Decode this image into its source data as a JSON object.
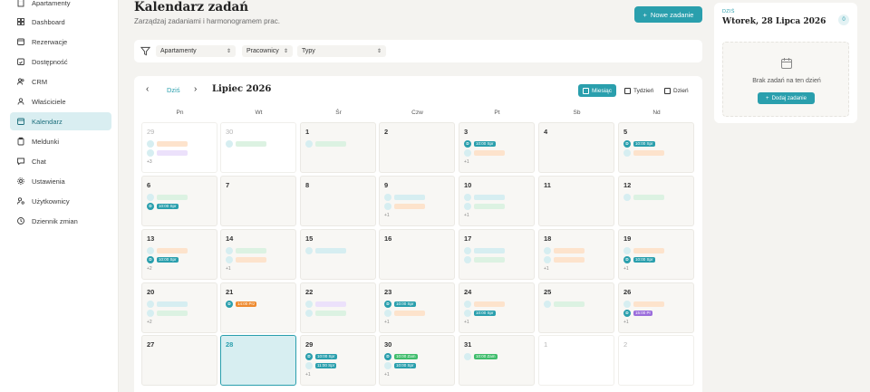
{
  "sidebar": {
    "items": [
      {
        "label": "Apartamenty",
        "icon": "building-icon",
        "active": false
      },
      {
        "label": "Dashboard",
        "icon": "grid-icon",
        "active": false
      },
      {
        "label": "Rezerwacje",
        "icon": "calendar-icon",
        "active": false
      },
      {
        "label": "Dostępność",
        "icon": "calendar-check-icon",
        "active": false
      },
      {
        "label": "CRM",
        "icon": "users-icon",
        "active": false
      },
      {
        "label": "Właściciele",
        "icon": "user-icon",
        "active": false
      },
      {
        "label": "Kalendarz",
        "icon": "calendar-icon",
        "active": true
      },
      {
        "label": "Meldunki",
        "icon": "clipboard-icon",
        "active": false
      },
      {
        "label": "Chat",
        "icon": "chat-icon",
        "active": false
      },
      {
        "label": "Ustawienia",
        "icon": "gear-icon",
        "active": false
      },
      {
        "label": "Użytkownicy",
        "icon": "user-cog-icon",
        "active": false
      },
      {
        "label": "Dziennik zmian",
        "icon": "history-icon",
        "active": false
      }
    ]
  },
  "header": {
    "title": "Kalendarz zadań",
    "subtitle": "Zarządzaj zadaniami i harmonogramem prac.",
    "new_task_label": "Nowe zadanie"
  },
  "filters": {
    "apartments": "Apartamenty",
    "workers": "Pracownicy",
    "types": "Typy"
  },
  "calendar": {
    "today_label": "Dziś",
    "month_label": "Lipiec 2026",
    "views": [
      {
        "label": "Miesiąc",
        "active": true
      },
      {
        "label": "Tydzień",
        "active": false
      },
      {
        "label": "Dzień",
        "active": false
      }
    ],
    "weekdays": [
      "Pn",
      "Wt",
      "Śr",
      "Czw",
      "Pt",
      "Sb",
      "Nd"
    ],
    "colors": {
      "teal": "#2a9fad",
      "green": "#3fbd6b",
      "orange": "#ee8a2e",
      "purple": "#9b6ddb",
      "light_green": "#dcf2e2",
      "light_orange": "#fde3cc",
      "light_purple": "#ece1fb",
      "light_teal": "#d6eef1"
    },
    "weeks": [
      [
        {
          "day": "29",
          "outside": true,
          "events": [
            {
              "dot": "",
              "color": "light_teal",
              "pill": "",
              "pill_color": "light_orange"
            },
            {
              "dot": "",
              "color": "light_teal",
              "pill": "",
              "pill_color": "light_purple"
            }
          ],
          "more": "+3"
        },
        {
          "day": "30",
          "outside": true,
          "events": [
            {
              "dot": "",
              "color": "light_teal",
              "pill": "",
              "pill_color": "light_green"
            }
          ],
          "more": ""
        },
        {
          "day": "1",
          "events": [
            {
              "dot": "",
              "color": "light_teal",
              "pill": "",
              "pill_color": "light_green"
            }
          ],
          "more": ""
        },
        {
          "day": "2",
          "events": [],
          "more": ""
        },
        {
          "day": "3",
          "events": [
            {
              "dot": "D",
              "color": "teal",
              "pill": "10:00 Spr",
              "pill_color": "teal"
            },
            {
              "dot": "",
              "color": "light_teal",
              "pill": "",
              "pill_color": "light_orange"
            }
          ],
          "more": "+1"
        },
        {
          "day": "4",
          "events": [],
          "more": ""
        },
        {
          "day": "5",
          "events": [
            {
              "dot": "D",
              "color": "teal",
              "pill": "10:00 Spr",
              "pill_color": "teal"
            },
            {
              "dot": "",
              "color": "light_teal",
              "pill": "",
              "pill_color": "light_orange"
            }
          ],
          "more": ""
        }
      ],
      [
        {
          "day": "6",
          "events": [
            {
              "dot": "",
              "color": "light_teal",
              "pill": "",
              "pill_color": "light_green"
            },
            {
              "dot": "D",
              "color": "teal",
              "pill": "10:00 Spr",
              "pill_color": "teal"
            }
          ],
          "more": ""
        },
        {
          "day": "7",
          "events": [],
          "more": ""
        },
        {
          "day": "8",
          "events": [],
          "more": ""
        },
        {
          "day": "9",
          "events": [
            {
              "dot": "",
              "color": "light_teal",
              "pill": "",
              "pill_color": "light_teal"
            },
            {
              "dot": "",
              "color": "light_teal",
              "pill": "",
              "pill_color": "light_orange"
            }
          ],
          "more": "+1"
        },
        {
          "day": "10",
          "events": [
            {
              "dot": "",
              "color": "light_teal",
              "pill": "",
              "pill_color": "light_teal"
            },
            {
              "dot": "",
              "color": "light_teal",
              "pill": "",
              "pill_color": "light_green"
            }
          ],
          "more": "+1"
        },
        {
          "day": "11",
          "events": [],
          "more": ""
        },
        {
          "day": "12",
          "events": [
            {
              "dot": "",
              "color": "light_teal",
              "pill": "",
              "pill_color": "light_green"
            }
          ],
          "more": ""
        }
      ],
      [
        {
          "day": "13",
          "events": [
            {
              "dot": "",
              "color": "light_teal",
              "pill": "",
              "pill_color": "light_orange"
            },
            {
              "dot": "D",
              "color": "teal",
              "pill": "10:00 Spr",
              "pill_color": "teal"
            }
          ],
          "more": "+2"
        },
        {
          "day": "14",
          "events": [
            {
              "dot": "",
              "color": "light_teal",
              "pill": "",
              "pill_color": "light_green"
            },
            {
              "dot": "",
              "color": "light_teal",
              "pill": "",
              "pill_color": "light_orange"
            }
          ],
          "more": "+1"
        },
        {
          "day": "15",
          "events": [
            {
              "dot": "",
              "color": "light_teal",
              "pill": "",
              "pill_color": "light_teal"
            }
          ],
          "more": ""
        },
        {
          "day": "16",
          "events": [],
          "more": ""
        },
        {
          "day": "17",
          "events": [
            {
              "dot": "",
              "color": "light_teal",
              "pill": "",
              "pill_color": "light_teal"
            },
            {
              "dot": "",
              "color": "light_teal",
              "pill": "",
              "pill_color": "light_green"
            }
          ],
          "more": ""
        },
        {
          "day": "18",
          "events": [
            {
              "dot": "",
              "color": "light_teal",
              "pill": "",
              "pill_color": "light_orange"
            },
            {
              "dot": "",
              "color": "light_teal",
              "pill": "",
              "pill_color": "light_orange"
            }
          ],
          "more": "+1"
        },
        {
          "day": "19",
          "events": [
            {
              "dot": "",
              "color": "light_teal",
              "pill": "",
              "pill_color": "light_orange"
            },
            {
              "dot": "D",
              "color": "teal",
              "pill": "10:00 Spr",
              "pill_color": "teal"
            }
          ],
          "more": "+1"
        }
      ],
      [
        {
          "day": "20",
          "events": [
            {
              "dot": "",
              "color": "light_teal",
              "pill": "",
              "pill_color": "light_teal"
            },
            {
              "dot": "",
              "color": "light_teal",
              "pill": "",
              "pill_color": "light_green"
            }
          ],
          "more": "+2"
        },
        {
          "day": "21",
          "events": [
            {
              "dot": "D",
              "color": "teal",
              "pill": "14:00 Prz",
              "pill_color": "orange"
            }
          ],
          "more": ""
        },
        {
          "day": "22",
          "events": [
            {
              "dot": "",
              "color": "light_teal",
              "pill": "",
              "pill_color": "light_purple"
            },
            {
              "dot": "",
              "color": "light_teal",
              "pill": "",
              "pill_color": "light_green"
            }
          ],
          "more": ""
        },
        {
          "day": "23",
          "events": [
            {
              "dot": "D",
              "color": "teal",
              "pill": "10:00 Spr",
              "pill_color": "teal"
            },
            {
              "dot": "",
              "color": "light_teal",
              "pill": "",
              "pill_color": "light_orange"
            }
          ],
          "more": "+1"
        },
        {
          "day": "24",
          "events": [
            {
              "dot": "",
              "color": "light_teal",
              "pill": "",
              "pill_color": "light_orange"
            },
            {
              "dot": "",
              "color": "light_teal",
              "pill": "10:00 Spr",
              "pill_color": "teal"
            }
          ],
          "more": "+1"
        },
        {
          "day": "25",
          "events": [
            {
              "dot": "",
              "color": "light_teal",
              "pill": "",
              "pill_color": "light_green"
            }
          ],
          "more": ""
        },
        {
          "day": "26",
          "events": [
            {
              "dot": "",
              "color": "light_teal",
              "pill": "",
              "pill_color": "light_orange"
            },
            {
              "dot": "D",
              "color": "teal",
              "pill": "15:00 Pr",
              "pill_color": "purple"
            }
          ],
          "more": "+1"
        }
      ],
      [
        {
          "day": "27",
          "events": [],
          "more": ""
        },
        {
          "day": "28",
          "today": true,
          "events": [],
          "more": ""
        },
        {
          "day": "29",
          "events": [
            {
              "dot": "D",
              "color": "teal",
              "pill": "10:00 Spr",
              "pill_color": "teal"
            },
            {
              "dot": "",
              "color": "light_teal",
              "pill": "11:00 Spr",
              "pill_color": "teal"
            }
          ],
          "more": "+1"
        },
        {
          "day": "30",
          "events": [
            {
              "dot": "D",
              "color": "teal",
              "pill": "10:00 Zam",
              "pill_color": "green"
            },
            {
              "dot": "",
              "color": "light_teal",
              "pill": "10:00 Spr",
              "pill_color": "teal"
            }
          ],
          "more": "+1"
        },
        {
          "day": "31",
          "events": [
            {
              "dot": "",
              "color": "light_teal",
              "pill": "10:00 Zam",
              "pill_color": "green"
            }
          ],
          "more": ""
        },
        {
          "day": "1",
          "outside": true,
          "events": [],
          "more": ""
        },
        {
          "day": "2",
          "outside": true,
          "events": [],
          "more": ""
        }
      ]
    ]
  },
  "today_panel": {
    "label": "DZIŚ",
    "date": "Wtorek, 28 Lipca 2026",
    "count": "0",
    "empty_text": "Brak zadań na ten dzień",
    "add_label": "Dodaj zadanie"
  }
}
